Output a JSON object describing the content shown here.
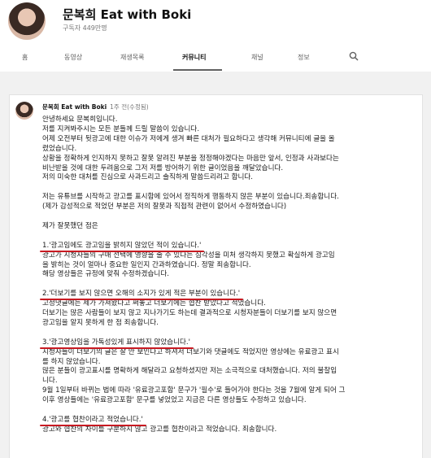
{
  "channel": {
    "name": "문복희 Eat with Boki",
    "subscribers": "구독자 449만명"
  },
  "tabs": [
    {
      "label": "홈"
    },
    {
      "label": "동영상"
    },
    {
      "label": "재생목록"
    },
    {
      "label": "커뮤니티"
    },
    {
      "label": "채널"
    },
    {
      "label": "정보"
    }
  ],
  "active_tab": "커뮤니티",
  "post": {
    "author": "문복희 Eat with Boki",
    "time": "1주 전(수정됨)",
    "lines": [
      "안녕하세요 문복희입니다.",
      "저를 지켜봐주시는 모든 분들께 드릴 말씀이 있습니다.",
      "어제 오전부터 뒷광고에 대한 이슈가 저에게 생겨 빠른 대처가 필요하다고 생각해 커뮤니티에 글을 올",
      "렸었습니다.",
      "상황을 정확하게 인지하지 못하고 잘못 알려진 부분을 정정해야겠다는 마음만 앞서, 인정과 사과보다는",
      "비난받을 것에 대한 두려움으로 그저 저를 방어하기 위한 글이었음을 깨달았습니다.",
      "저의 미숙한 대처를 진심으로 사과드리고 솔직하게 말씀드리려고 합니다.",
      "",
      "저는 유튜브를 시작하고 광고를 표시함에 있어서 정직하게 행동하지 않은 부분이 있습니다.죄송합니다.",
      "(제가 감성적으로 적었던 부분은 저의 잘못과 직접적 관련이 없어서 수정하였습니다)",
      "",
      "제가 잘못했던 점은",
      "",
      "1.'광고임에도 광고임을 밝히지 않았던 적이 있습니다.'",
      "광고가 시청자들의 구매 선택에 영향을 줄 수 있다는 심각성을 미처 생각하지 못했고 확실하게 광고임",
      "을 밝히는 것이 얼마나 중요한 일인지 간과하였습니다. 정말 죄송합니다.",
      "해당 영상들은 규정에 맞춰 수정하겠습니다.",
      "",
      "2.'더보기를 보지 않으면 오해의 소지가 있게 적은 부분이 있습니다.'",
      "고정댓글에는 제가 가져왔다고 써놓고 더보기에는 협찬 받았다고 적었습니다.",
      "더보기는 많은 사람들이 보지 않고 지나가기도 하는데 결과적으로 시청자분들이 더보기를 보지 않으면",
      "광고임을 알지 못하게 한 점 죄송합니다.",
      "",
      "3.'광고영상임을 가독성있게 표시하지 않았습니다.'",
      "시청자들이 더보기의 글은 잘 안 보인다고 하셔서 더보기와 댓글에도 적었지만 영상에는 유료광고 표시",
      "를 하지 않았습니다.",
      "많은 분들이 광고표시를 명확하게 해달라고 요청하셨지만 저는 소극적으로 대처했습니다. 저의 불찰입",
      "니다.",
      "9월 1일부터 바뀌는 법에 따라 '유료광고포함' 문구가 '필수'로 들어가야 한다는 것을 7월에 알게 되어 그",
      "이후 영상들에는 '유료광고포함' 문구를 넣었었고 지금은 다른 영상들도 수정하고 있습니다.",
      "",
      "4.'광고를 협찬이라고 적었습니다.'",
      "광고와 협찬의 차이를 구분하지 않고 광고를 협찬이라고 적었습니다. 죄송합니다."
    ]
  },
  "icons": {
    "search": "search-icon"
  },
  "colors": {
    "underline_accent": "#c81a22"
  }
}
